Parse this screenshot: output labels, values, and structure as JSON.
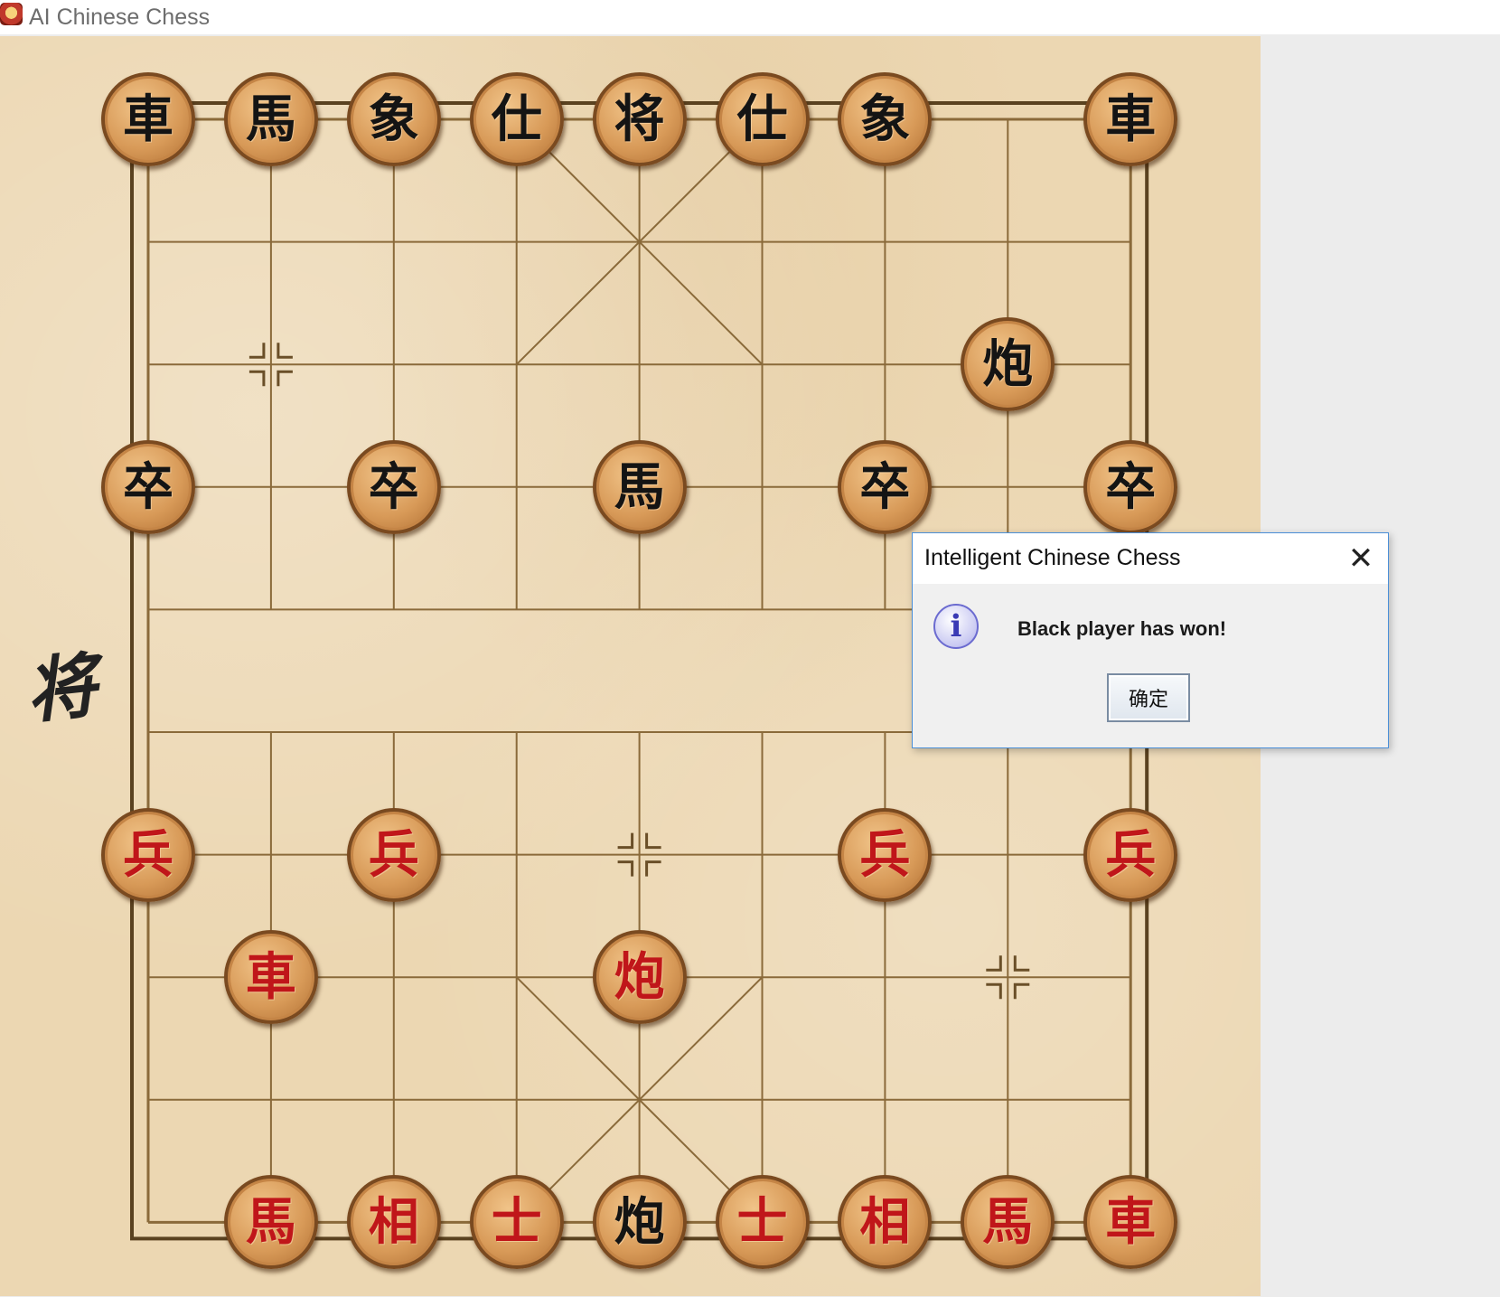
{
  "window": {
    "title": "AI Chinese Chess",
    "icon": "chess-app-icon"
  },
  "board": {
    "side_label": "将",
    "columns": 9,
    "rows": 10,
    "pieces": [
      {
        "char": "車",
        "side": "black",
        "col": 0,
        "row": 0
      },
      {
        "char": "馬",
        "side": "black",
        "col": 1,
        "row": 0
      },
      {
        "char": "象",
        "side": "black",
        "col": 2,
        "row": 0
      },
      {
        "char": "仕",
        "side": "black",
        "col": 3,
        "row": 0
      },
      {
        "char": "将",
        "side": "black",
        "col": 4,
        "row": 0
      },
      {
        "char": "仕",
        "side": "black",
        "col": 5,
        "row": 0
      },
      {
        "char": "象",
        "side": "black",
        "col": 6,
        "row": 0
      },
      {
        "char": "車",
        "side": "black",
        "col": 8,
        "row": 0
      },
      {
        "char": "炮",
        "side": "black",
        "col": 7,
        "row": 2
      },
      {
        "char": "卒",
        "side": "black",
        "col": 0,
        "row": 3
      },
      {
        "char": "卒",
        "side": "black",
        "col": 2,
        "row": 3
      },
      {
        "char": "馬",
        "side": "black",
        "col": 4,
        "row": 3
      },
      {
        "char": "卒",
        "side": "black",
        "col": 6,
        "row": 3
      },
      {
        "char": "卒",
        "side": "black",
        "col": 8,
        "row": 3
      },
      {
        "char": "兵",
        "side": "red",
        "col": 0,
        "row": 6
      },
      {
        "char": "兵",
        "side": "red",
        "col": 2,
        "row": 6
      },
      {
        "char": "兵",
        "side": "red",
        "col": 6,
        "row": 6
      },
      {
        "char": "兵",
        "side": "red",
        "col": 8,
        "row": 6
      },
      {
        "char": "車",
        "side": "red",
        "col": 1,
        "row": 7
      },
      {
        "char": "炮",
        "side": "red",
        "col": 4,
        "row": 7
      },
      {
        "char": "馬",
        "side": "red",
        "col": 1,
        "row": 9
      },
      {
        "char": "相",
        "side": "red",
        "col": 2,
        "row": 9
      },
      {
        "char": "士",
        "side": "red",
        "col": 3,
        "row": 9
      },
      {
        "char": "炮",
        "side": "black",
        "col": 4,
        "row": 9
      },
      {
        "char": "士",
        "side": "red",
        "col": 5,
        "row": 9
      },
      {
        "char": "相",
        "side": "red",
        "col": 6,
        "row": 9
      },
      {
        "char": "馬",
        "side": "red",
        "col": 7,
        "row": 9
      },
      {
        "char": "車",
        "side": "red",
        "col": 8,
        "row": 9
      }
    ]
  },
  "dialog": {
    "title": "Intelligent Chinese Chess",
    "message": "Black player has won!",
    "ok_label": "确定",
    "close_icon": "close-icon",
    "info_icon": "info-icon"
  }
}
